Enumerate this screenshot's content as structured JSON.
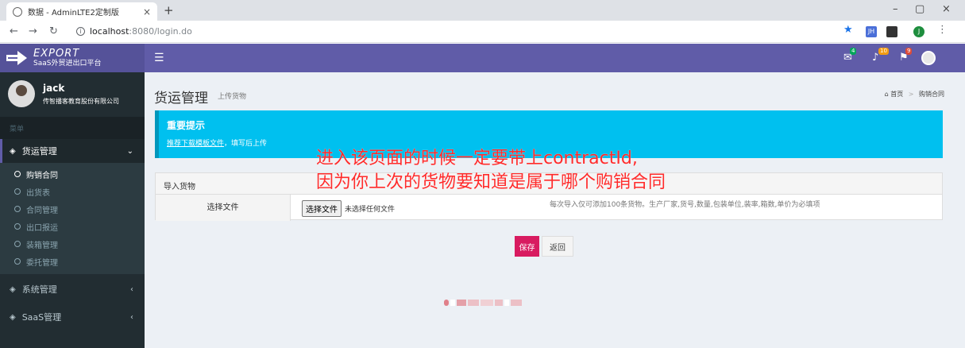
{
  "browser": {
    "tab_title": "数据 - AdminLTE2定制版",
    "tab_close": "×",
    "new_tab": "+",
    "win_minimize": "–",
    "win_maximize": "▢",
    "win_close": "×",
    "url_host": "localhost",
    "url_path": ":8080/login.do",
    "ext_jh": "JH",
    "ext_profile": "J"
  },
  "app": {
    "logo_title": "EXPORT",
    "logo_subtitle": "SaaS外贸进出口平台",
    "header_badges": {
      "mail": "4",
      "bell": "10",
      "flag": "9"
    },
    "colors": {
      "brand": "#605ca8",
      "sidebar": "#222d32",
      "callout": "#00c0ef",
      "save": "#d81b60",
      "annotation": "#ff2b2b"
    }
  },
  "sidebar": {
    "user_name": "jack",
    "user_company": "传智播客教育股份有限公司",
    "menu_header": "菜单",
    "cargo_menu": "货运管理",
    "cargo_caret": "⌄",
    "sub_items": [
      "购销合同",
      "出货表",
      "合同管理",
      "出口报运",
      "装箱管理",
      "委托管理"
    ],
    "system_menu": "系统管理",
    "saas_menu": "SaaS管理",
    "collapse_caret": "‹"
  },
  "content": {
    "title": "货运管理",
    "subtitle": "上传货物",
    "breadcrumb_home": "首页",
    "breadcrumb_current": "购销合同",
    "callout_title": "重要提示",
    "callout_link": "推荐下载模板文件",
    "callout_rest": "，填写后上传",
    "panel_title": "导入货物",
    "file_label": "选择文件",
    "file_button": "选择文件",
    "file_none": "未选择任何文件",
    "hint": "每次导入仅可添加100条货物。生产厂家,货号,数量,包装单位,装率,箱数,单价为必填项",
    "save": "保存",
    "back": "返回"
  },
  "annotation": {
    "line1": "进入该页面的时候一定要带上contractId,",
    "line2": "因为你上次的货物要知道是属于哪个购销合同"
  }
}
